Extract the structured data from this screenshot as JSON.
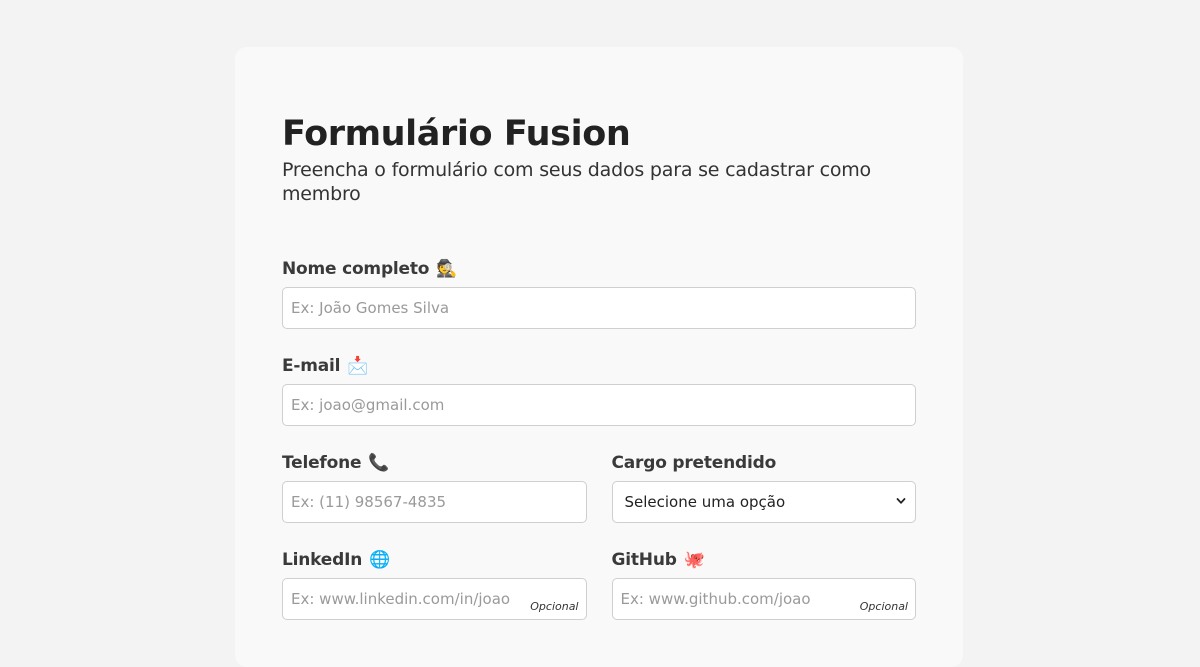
{
  "header": {
    "title": "Formulário Fusion",
    "subtitle": "Preencha o formulário com seus dados para se cadastrar como membro"
  },
  "fields": {
    "name": {
      "label": "Nome completo",
      "icon": "person-icon",
      "emoji": "🕵",
      "placeholder": "Ex: João Gomes Silva",
      "value": ""
    },
    "email": {
      "label": "E-mail",
      "icon": "envelope-icon",
      "emoji": "📩",
      "placeholder": "Ex: joao@gmail.com",
      "value": ""
    },
    "phone": {
      "label": "Telefone",
      "icon": "telephone-receiver-icon",
      "emoji": "📞",
      "placeholder": "Ex: (11) 98567-4835",
      "value": ""
    },
    "role": {
      "label": "Cargo pretendido",
      "selected": "Selecione uma opção"
    },
    "linkedin": {
      "label": "LinkedIn",
      "icon": "globe-icon",
      "emoji": "🌐",
      "placeholder": "Ex: www.linkedin.com/in/joao",
      "value": "",
      "optional": "Opcional"
    },
    "github": {
      "label": "GitHub",
      "icon": "octopus-icon",
      "emoji": "🐙",
      "placeholder": "Ex: www.github.com/joao",
      "value": "",
      "optional": "Opcional"
    }
  },
  "colors": {
    "page_background": "#f3f3f3",
    "card_background": "#f9f9f9",
    "input_border": "#cfcfcf",
    "placeholder": "#9a9a9a"
  }
}
